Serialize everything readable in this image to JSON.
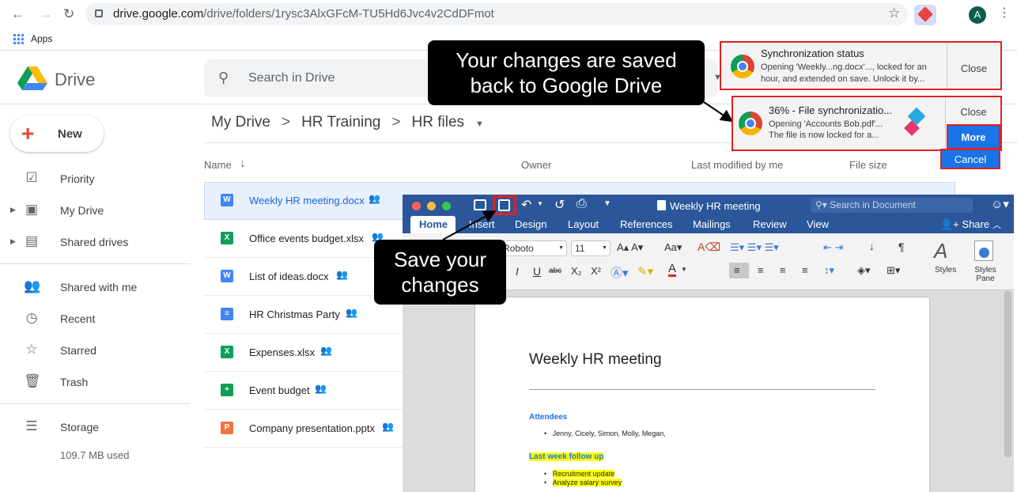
{
  "browser": {
    "url_host": "drive.google.com",
    "url_path": "/drive/folders/1rysc3AlxGFcM-TU5Hd6Jvc4v2CdDFmot",
    "apps_label": "Apps",
    "avatar_letter": "A"
  },
  "drive": {
    "product_name": "Drive",
    "search_placeholder": "Search in Drive",
    "new_label": "New",
    "sidebar": [
      "Priority",
      "My Drive",
      "Shared drives",
      "Shared with me",
      "Recent",
      "Starred",
      "Trash",
      "Storage"
    ],
    "storage_used": "109.7 MB used",
    "breadcrumb": [
      "My Drive",
      ">",
      "HR Training",
      ">",
      "HR files"
    ],
    "columns": [
      "Name",
      "Owner",
      "Last modified by me",
      "File size"
    ],
    "files": [
      {
        "name": "Weekly HR meeting.docx",
        "type": "W",
        "color": "#4285f4"
      },
      {
        "name": "Office events budget.xlsx",
        "type": "X",
        "color": "#0f9d58"
      },
      {
        "name": "List of ideas.docx",
        "type": "W",
        "color": "#4285f4"
      },
      {
        "name": "HR Christmas Party",
        "type": "≡",
        "color": "#4285f4"
      },
      {
        "name": "Expenses.xlsx",
        "type": "X",
        "color": "#0f9d58"
      },
      {
        "name": "Event budget",
        "type": "+",
        "color": "#0f9d58"
      },
      {
        "name": "Company presentation.pptx",
        "type": "P",
        "color": "#f4733c"
      }
    ]
  },
  "word": {
    "doc_title": "Weekly HR meeting",
    "search_placeholder": "Search in Document",
    "tabs": [
      "Home",
      "Insert",
      "Design",
      "Layout",
      "References",
      "Mailings",
      "Review",
      "View"
    ],
    "share_label": "Share",
    "font_name": "Roboto",
    "font_size": "11",
    "styles_label": "Styles",
    "styles_pane_label": "Styles Pane",
    "page": {
      "heading": "Weekly HR meeting",
      "attendees_heading": "Attendees",
      "attendees": "Jenny, Cicely, Simon, Molly, Megan,",
      "followup_heading": "Last week follow up",
      "followup_items": [
        "Recruitment update",
        "Analyze salary survey"
      ]
    }
  },
  "callouts": {
    "top": "Your changes are saved back to Google Drive",
    "save": "Save your changes"
  },
  "notifications": {
    "n1": {
      "title": "Synchronization status",
      "line1": "Opening 'Weekly...ng.docx'..., locked for an",
      "line2": "hour, and extended on save. Unlock it by...",
      "close": "Close"
    },
    "n2": {
      "title": "36% - File synchronizatio...",
      "line1": "Opening 'Accounts Bob.pdf'...",
      "line2": "The file is now locked for a...",
      "close": "Close",
      "more": "More",
      "cancel": "Cancel"
    }
  },
  "colors": {
    "word_blue": "#2b579a",
    "highlight_red": "#e32020",
    "more_blue": "#1a73e8"
  }
}
